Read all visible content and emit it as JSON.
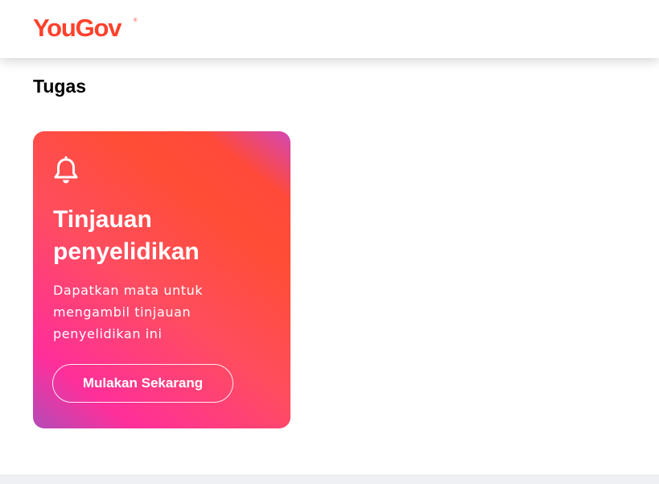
{
  "header": {
    "logo_text": "YouGov",
    "logo_mark": "®",
    "logo_color": "#ff412c"
  },
  "page": {
    "title": "Tugas"
  },
  "task_card": {
    "icon": "bell-icon",
    "title": "Tinjauan penyelidikan",
    "description": "Dapatkan mata untuk mengambil tinjauan penyelidikan ini",
    "button_label": "Mulakan Sekarang",
    "gradient_colors": [
      "#b34bb8",
      "#ff2f9a",
      "#ff4d5f",
      "#ff4d36",
      "#d447b4"
    ]
  },
  "colors": {
    "footer_strip": "#eff0f3",
    "background": "#ffffff"
  }
}
